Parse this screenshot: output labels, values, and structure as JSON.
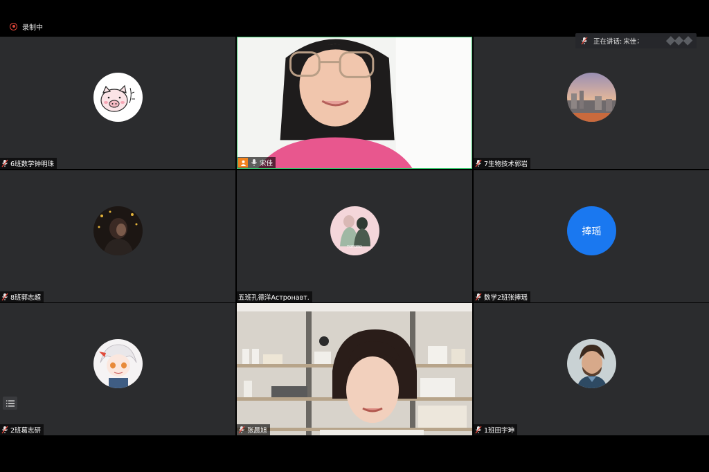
{
  "recording": {
    "label": "录制中",
    "color": "#e0463a"
  },
  "active_speaker": {
    "prefix": "正在讲话: ",
    "name": "宋佳"
  },
  "participants": [
    {
      "name": "6班数学钟明珠",
      "avatar": "pig-sketch"
    },
    {
      "name": "宋佳",
      "host": true,
      "video": true
    },
    {
      "name": "7生物技术郭岩",
      "avatar": "city-photo"
    },
    {
      "name": "8班郭志超",
      "avatar": "night-portrait"
    },
    {
      "name": "五班孔德洋Астронавт.",
      "avatar": "couple-illustration"
    },
    {
      "name": "数学2班张捧瑶",
      "avatar_text": "捧瑶",
      "avatar_color": "#1a78f0"
    },
    {
      "name": "2班葛志研",
      "avatar": "anime-character"
    },
    {
      "name": "张晨旭",
      "video": true
    },
    {
      "name": "1班田宇珅",
      "avatar": "man-portrait"
    }
  ],
  "icons": {
    "mic": "microphone-icon",
    "host": "host-person-icon",
    "record": "record-icon",
    "list": "participant-list-icon",
    "signal": "signal-icon"
  },
  "colors": {
    "tile_bg": "#2b2c2e",
    "speaker_border": "#35c46a",
    "host_badge": "#f0821e",
    "avatar_blue": "#1a78f0"
  }
}
